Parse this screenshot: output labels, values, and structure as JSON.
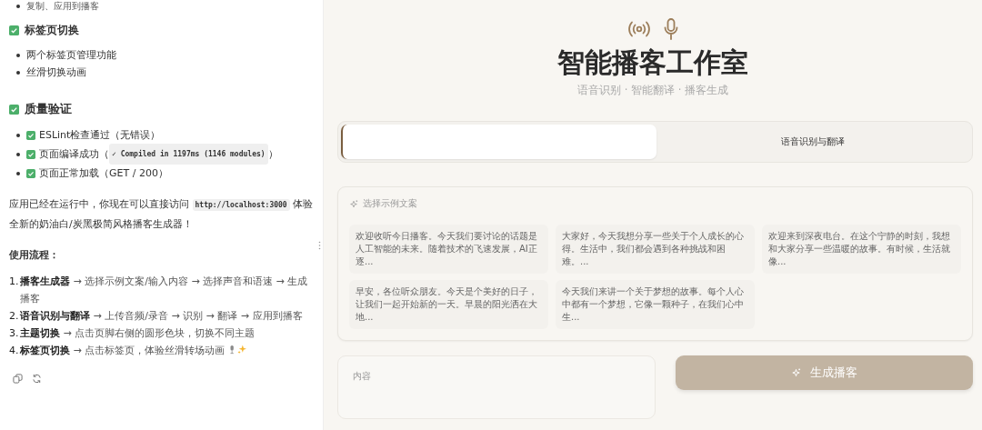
{
  "chat": {
    "top_bullet": "复制、应用到播客",
    "section_1": {
      "title": "标签页切换",
      "bullets": [
        "两个标签页管理功能",
        "丝滑切换动画"
      ]
    },
    "section_2": {
      "title": "质量验证",
      "checks": [
        {
          "text": "ESLint检查通过（无错误）"
        },
        {
          "text": "页面编译成功（",
          "code": "✓ Compiled in 1197ms (1146 modules)",
          "after": "）"
        },
        {
          "text": "页面正常加载（GET / 200）"
        }
      ]
    },
    "paragraph": {
      "before": "应用已经在运行中，你现在可以直接访问",
      "code": "http://localhost:3000",
      "after": "体验全新的奶油白/炭黑极简风格播客生成器！"
    },
    "flow_title": "使用流程：",
    "steps": [
      {
        "number": "1.",
        "text": "**播客生成器** → 选择示例文案/输入内容 → 选择声音和语速 → 生成播客"
      },
      {
        "number": "2.",
        "text": "**语音识别与翻译** → 上传音频/录音 → 识别 → 翻译 → 应用到播客"
      },
      {
        "number": "3.",
        "text": "**主题切换** → 点击页脚右侧的圆形色块，切换不同主题"
      },
      {
        "number": "4.",
        "text": "**标签页切换** → 点击标签页，体验丝滑转场动画",
        "emoji": true
      }
    ]
  },
  "app": {
    "title": "智能播客工作室",
    "subtitle": "语音识别 · 智能翻译 · 播客生成",
    "tabs": [
      {
        "selected": true
      },
      {
        "label": "语音识别与翻译",
        "selected": false
      }
    ],
    "examples": {
      "label": "选择示例文案",
      "items": [
        "欢迎收听今日播客。今天我们要讨论的话题是人工智能的未来。随着技术的飞速发展，AI正逐...",
        "大家好，今天我想分享一些关于个人成长的心得。生活中，我们都会遇到各种挑战和困难。...",
        "欢迎来到深夜电台。在这个宁静的时刻，我想和大家分享一些温暖的故事。有时候，生活就像...",
        "早安，各位听众朋友。今天是个美好的日子，让我们一起开始新的一天。早晨的阳光洒在大地...",
        "今天我们来讲一个关于梦想的故事。每个人心中都有一个梦想，它像一颗种子，在我们心中生..."
      ]
    },
    "content_label": "内容",
    "generate_button": "生成播客"
  }
}
